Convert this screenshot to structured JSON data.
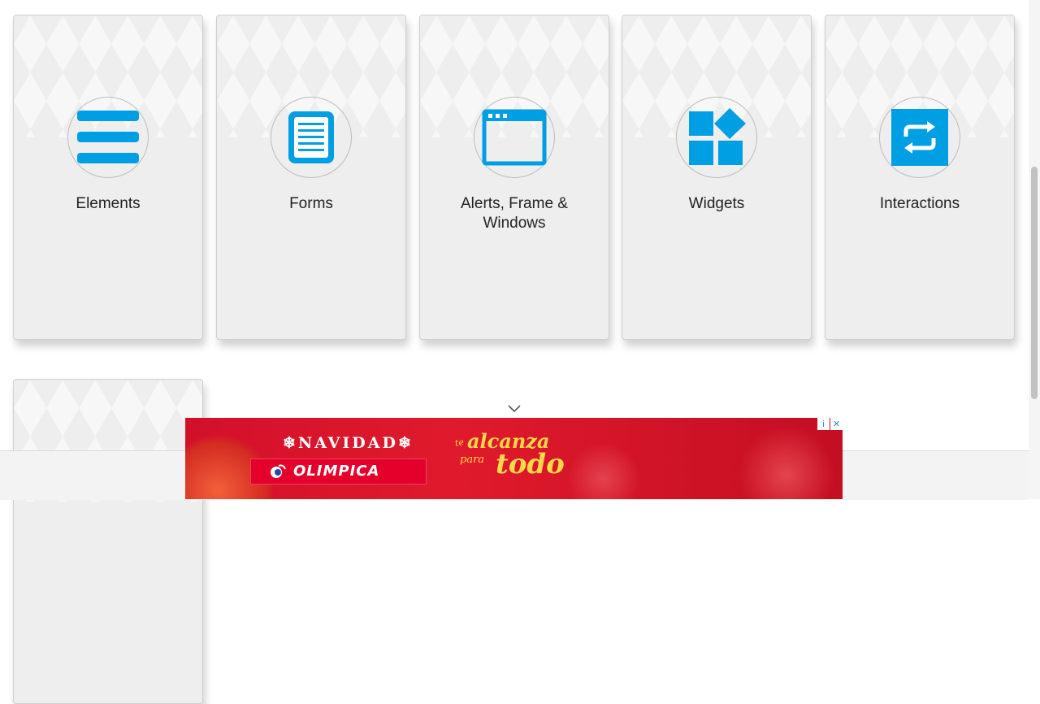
{
  "cards": [
    {
      "title": "Elements",
      "icon": "hamburger-icon"
    },
    {
      "title": "Forms",
      "icon": "document-icon"
    },
    {
      "title": "Alerts, Frame & Windows",
      "icon": "browser-window-icon"
    },
    {
      "title": "Widgets",
      "icon": "widgets-icon"
    },
    {
      "title": "Interactions",
      "icon": "repeat-icon"
    },
    {
      "title": "",
      "icon": ""
    }
  ],
  "ad": {
    "headline": "❄NAVIDAD❄",
    "brand": "OLIMPICA",
    "slogan_te": "te",
    "slogan_alcanza": "alcanza",
    "slogan_para": "para",
    "slogan_todo": "todo",
    "info_symbol": "i",
    "close_symbol": "✕"
  },
  "colors": {
    "accent": "#009fe3",
    "card_bg": "#eeeeee",
    "ad_red": "#e01a2c",
    "ad_gold": "#ffd84a"
  }
}
